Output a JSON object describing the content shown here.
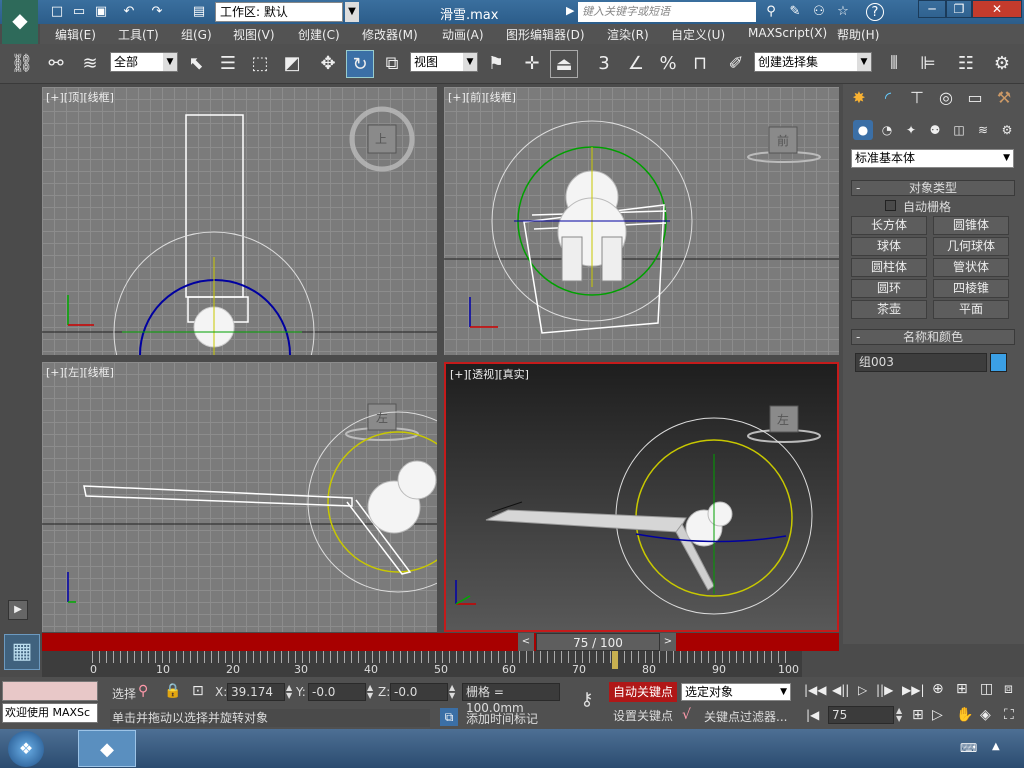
{
  "titlebar": {
    "workspace_label": "工作区: 默认",
    "title": "滑雪.max",
    "search_placeholder": "键入关键字或短语",
    "help": "?"
  },
  "menu": [
    "编辑(E)",
    "工具(T)",
    "组(G)",
    "视图(V)",
    "创建(C)",
    "修改器(M)",
    "动画(A)",
    "图形编辑器(D)",
    "渲染(R)",
    "自定义(U)",
    "MAXScript(X)",
    "帮助(H)"
  ],
  "toolbar": {
    "filter": "全部",
    "ref_coord": "视图",
    "snap_3": "3",
    "angle_snap": "%",
    "selection_set": "创建选择集"
  },
  "viewports": {
    "top": {
      "label": "[+][顶][线框]",
      "cube": "上"
    },
    "front": {
      "label": "[+][前][线框]",
      "cube": "前"
    },
    "left": {
      "label": "[+][左][线框]",
      "cube": "左"
    },
    "persp": {
      "label": "[+][透视][真实]",
      "cube": "左"
    }
  },
  "cmdpanel": {
    "category": "标准基本体",
    "object_type_title": "对象类型",
    "autogrid": "自动栅格",
    "buttons": [
      "长方体",
      "圆锥体",
      "球体",
      "几何球体",
      "圆柱体",
      "管状体",
      "圆环",
      "四棱锥",
      "茶壶",
      "平面"
    ],
    "name_color_title": "名称和颜色",
    "object_name": "组003",
    "object_color": "#3ba0e6"
  },
  "timeline": {
    "slider": "75 / 100",
    "ticks": [
      "0",
      "10",
      "20",
      "30",
      "40",
      "50",
      "60",
      "70",
      "80",
      "90",
      "100"
    ]
  },
  "status": {
    "listener": "欢迎使用 MAXSc",
    "selected": "选择",
    "x_label": "X:",
    "x": "39.174",
    "y_label": "Y:",
    "y": "-0.0",
    "z_label": "Z:",
    "z": "-0.0",
    "grid": "栅格 = 100.0mm",
    "prompt": "单击并拖动以选择并旋转对象",
    "add_time_tag": "添加时间标记",
    "auto_key": "自动关键点",
    "set_key": "设置关键点",
    "key_mode": "选定对象",
    "key_filters": "关键点过滤器...",
    "frame": "75"
  },
  "colors": {
    "accent_red": "#a80000",
    "title_blue": "#2c5d8a"
  }
}
